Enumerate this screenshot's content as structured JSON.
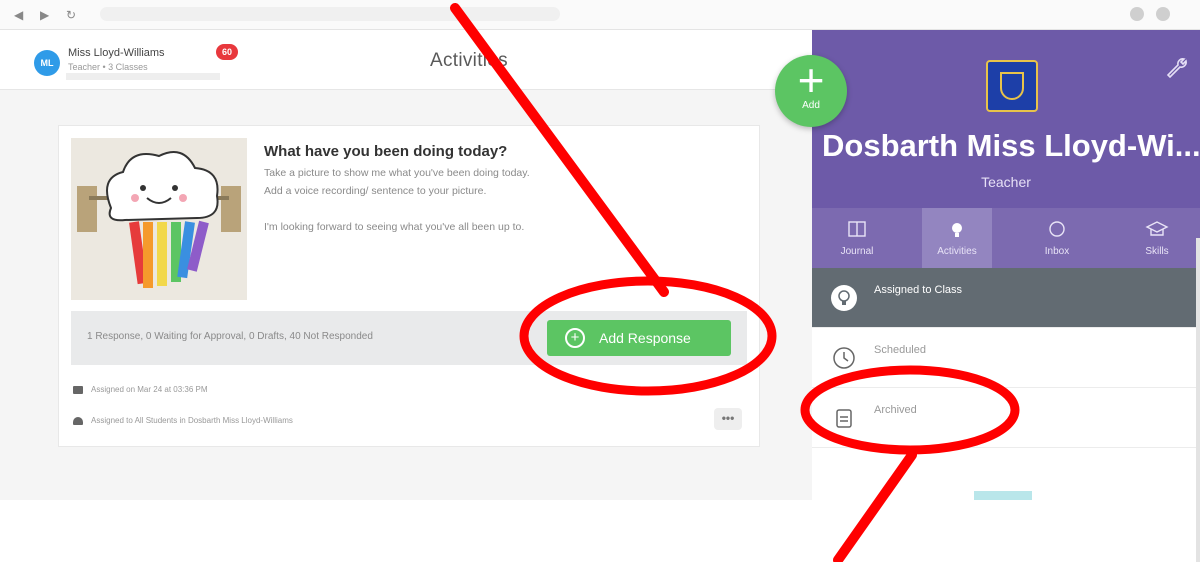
{
  "header": {
    "user_initials": "ML",
    "user_name": "Miss Lloyd-Williams",
    "user_subtitle": "Teacher • 3 Classes",
    "notification_count": "60",
    "page_title": "Activities"
  },
  "activity": {
    "title": "What have you been doing today?",
    "description_lines": [
      "Take a picture to show me what you've been doing today.",
      "Add a voice recording/ sentence to your picture.",
      "I'm looking forward to seeing what you've all been up to."
    ],
    "response_summary": "1 Response, 0 Waiting for Approval, 0 Drafts, 40 Not Responded",
    "add_response_label": "Add Response",
    "assigned_on": "Assigned on Mar 24 at 03:36 PM",
    "assigned_to": "Assigned to All Students in Dosbarth Miss Lloyd-Williams",
    "more_label": "•••"
  },
  "fab": {
    "plus": "+",
    "label": "Add"
  },
  "panel": {
    "class_name": "Dosbarth Miss Lloyd-Wi...",
    "role": "Teacher",
    "tabs": [
      {
        "label": "Journal",
        "icon": "book-icon"
      },
      {
        "label": "Activities",
        "icon": "lightbulb-icon"
      },
      {
        "label": "Inbox",
        "icon": "inbox-icon"
      },
      {
        "label": "Skills",
        "icon": "graduation-cap-icon"
      }
    ],
    "active_tab": "Activities",
    "filters": [
      {
        "label": "Assigned to Class",
        "icon": "lightbulb-icon",
        "selected": true
      },
      {
        "label": "Scheduled",
        "icon": "clock-icon",
        "selected": false
      },
      {
        "label": "Archived",
        "icon": "archive-icon",
        "selected": false
      }
    ]
  },
  "colors": {
    "accent_green": "#5cc563",
    "panel_purple": "#6d5aa8",
    "annotation_red": "#ff0000",
    "badge_red": "#e8383d"
  }
}
